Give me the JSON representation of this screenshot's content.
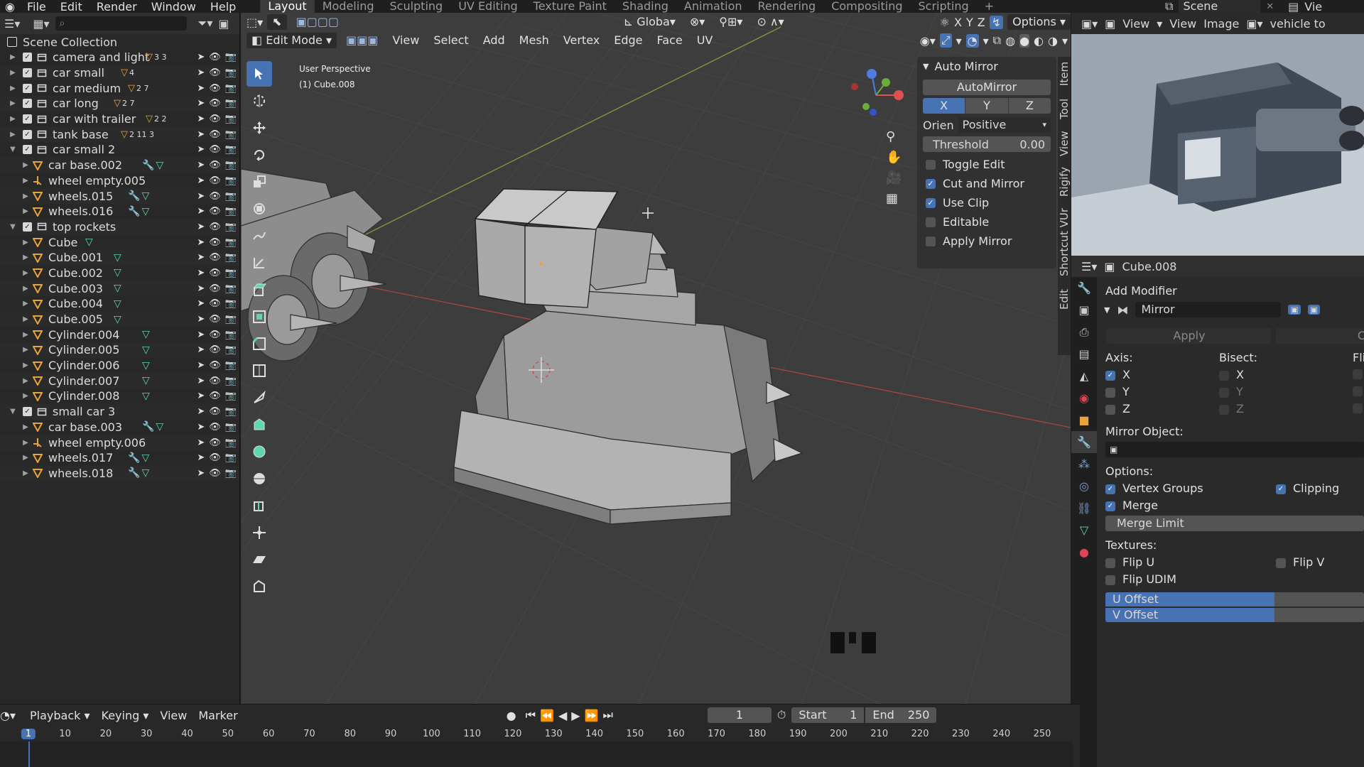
{
  "topbar": {
    "menus": [
      "File",
      "Edit",
      "Render",
      "Window",
      "Help"
    ],
    "workspaces": [
      "Layout",
      "Modeling",
      "Sculpting",
      "UV Editing",
      "Texture Paint",
      "Shading",
      "Animation",
      "Rendering",
      "Compositing",
      "Scripting"
    ],
    "active_workspace": "Layout",
    "add_tab": "+",
    "scene": "Scene",
    "viewlayer": "Vie"
  },
  "outliner": {
    "root": "Scene Collection",
    "rows": [
      {
        "label": "camera and light",
        "type": "collection",
        "depth": 0,
        "expanded": false,
        "badges": "3 3"
      },
      {
        "label": "car small",
        "type": "collection",
        "depth": 0,
        "expanded": false,
        "badges": "4"
      },
      {
        "label": "car medium",
        "type": "collection",
        "depth": 0,
        "expanded": false,
        "badges": "2 7"
      },
      {
        "label": "car long",
        "type": "collection",
        "depth": 0,
        "expanded": false,
        "badges": "2 7"
      },
      {
        "label": "car with trailer",
        "type": "collection",
        "depth": 0,
        "expanded": false,
        "badges": "2 2"
      },
      {
        "label": "tank base",
        "type": "collection",
        "depth": 0,
        "expanded": false,
        "badges": "2 11 3"
      },
      {
        "label": "car small 2",
        "type": "collection",
        "depth": 0,
        "expanded": true,
        "badges": ""
      },
      {
        "label": "car base.002",
        "type": "mesh",
        "depth": 1,
        "expanded": false,
        "badges": "mod"
      },
      {
        "label": "wheel empty.005",
        "type": "empty",
        "depth": 1,
        "expanded": false,
        "badges": ""
      },
      {
        "label": "wheels.015",
        "type": "mesh",
        "depth": 1,
        "expanded": false,
        "badges": "mod"
      },
      {
        "label": "wheels.016",
        "type": "mesh",
        "depth": 1,
        "expanded": false,
        "badges": "mod"
      },
      {
        "label": "top rockets",
        "type": "collection",
        "depth": 0,
        "expanded": true,
        "badges": ""
      },
      {
        "label": "Cube",
        "type": "mesh",
        "depth": 1,
        "expanded": false,
        "badges": "mesh"
      },
      {
        "label": "Cube.001",
        "type": "mesh",
        "depth": 1,
        "expanded": false,
        "badges": "mesh"
      },
      {
        "label": "Cube.002",
        "type": "mesh",
        "depth": 1,
        "expanded": false,
        "badges": "mesh"
      },
      {
        "label": "Cube.003",
        "type": "mesh",
        "depth": 1,
        "expanded": false,
        "badges": "mesh"
      },
      {
        "label": "Cube.004",
        "type": "mesh",
        "depth": 1,
        "expanded": false,
        "badges": "mesh"
      },
      {
        "label": "Cube.005",
        "type": "mesh",
        "depth": 1,
        "expanded": false,
        "badges": "mesh"
      },
      {
        "label": "Cylinder.004",
        "type": "mesh",
        "depth": 1,
        "expanded": false,
        "badges": "mesh"
      },
      {
        "label": "Cylinder.005",
        "type": "mesh",
        "depth": 1,
        "expanded": false,
        "badges": "mesh"
      },
      {
        "label": "Cylinder.006",
        "type": "mesh",
        "depth": 1,
        "expanded": false,
        "badges": "mesh"
      },
      {
        "label": "Cylinder.007",
        "type": "mesh",
        "depth": 1,
        "expanded": false,
        "badges": "mesh"
      },
      {
        "label": "Cylinder.008",
        "type": "mesh",
        "depth": 1,
        "expanded": false,
        "badges": "mesh"
      },
      {
        "label": "small car 3",
        "type": "collection",
        "depth": 0,
        "expanded": true,
        "badges": ""
      },
      {
        "label": "car base.003",
        "type": "mesh",
        "depth": 1,
        "expanded": false,
        "badges": "mod"
      },
      {
        "label": "wheel empty.006",
        "type": "empty",
        "depth": 1,
        "expanded": false,
        "badges": ""
      },
      {
        "label": "wheels.017",
        "type": "mesh",
        "depth": 1,
        "expanded": false,
        "badges": "mod"
      },
      {
        "label": "wheels.018",
        "type": "mesh",
        "depth": 1,
        "expanded": false,
        "badges": "mod"
      }
    ]
  },
  "viewport": {
    "header": {
      "orientation": "Globa",
      "axes": [
        "X",
        "Y",
        "Z"
      ],
      "options": "Options",
      "mode": "Edit Mode",
      "menus": [
        "View",
        "Select",
        "Add",
        "Mesh",
        "Vertex",
        "Edge",
        "Face",
        "UV"
      ]
    },
    "overlay_text": {
      "perspective": "User Perspective",
      "object": "(1) Cube.008"
    },
    "side_tabs": [
      "Item",
      "Tool",
      "View",
      "Rigify",
      "Shortcut VUr",
      "Edit"
    ]
  },
  "auto_mirror": {
    "title": "Auto Mirror",
    "button": "AutoMirror",
    "axes": [
      {
        "label": "X",
        "on": true
      },
      {
        "label": "Y",
        "on": false
      },
      {
        "label": "Z",
        "on": false
      }
    ],
    "orientation_label": "Orien",
    "orientation_value": "Positive",
    "threshold_label": "Threshold",
    "threshold_value": "0.00",
    "checkboxes": [
      {
        "label": "Toggle Edit",
        "on": false
      },
      {
        "label": "Cut and Mirror",
        "on": true
      },
      {
        "label": "Use Clip",
        "on": true
      },
      {
        "label": "Editable",
        "on": false
      },
      {
        "label": "Apply Mirror",
        "on": false
      }
    ]
  },
  "image_editor": {
    "menus": [
      "View",
      "View",
      "Image"
    ],
    "image_name": "vehicle to"
  },
  "properties": {
    "object_name": "Cube.008",
    "add_modifier": "Add Modifier",
    "modifier_name": "Mirror",
    "apply": "Apply",
    "apply_partial": "C",
    "axis_label": "Axis:",
    "bisect_label": "Bisect:",
    "flip_label": "Fli",
    "axis": [
      {
        "label": "X",
        "on": true
      },
      {
        "label": "Y",
        "on": false
      },
      {
        "label": "Z",
        "on": false
      }
    ],
    "bisect": [
      {
        "label": "X",
        "on": false
      },
      {
        "label": "Y",
        "on": false
      },
      {
        "label": "Z",
        "on": false
      }
    ],
    "mirror_object_label": "Mirror Object:",
    "options_label": "Options:",
    "vertex_groups": "Vertex Groups",
    "clipping": "Clipping",
    "merge": "Merge",
    "merge_limit": "Merge Limit",
    "textures_label": "Textures:",
    "flip_u": "Flip U",
    "flip_v": "Flip V",
    "flip_udim": "Flip UDIM",
    "u_offset": "U Offset",
    "v_offset": "V Offset"
  },
  "timeline": {
    "menus": [
      "Playback",
      "Keying",
      "View",
      "Marker"
    ],
    "current_frame": "1",
    "start_label": "Start",
    "start": "1",
    "end_label": "End",
    "end": "250",
    "ruler": [
      "1",
      "10",
      "20",
      "30",
      "40",
      "50",
      "60",
      "70",
      "80",
      "90",
      "100",
      "110",
      "120",
      "130",
      "140",
      "150",
      "160",
      "170",
      "180",
      "190",
      "200",
      "210",
      "220",
      "230",
      "240",
      "250"
    ]
  },
  "colors": {
    "accent": "#4772b3",
    "collection_icon": "#e8a33d",
    "mesh_icon": "#5fd6b0",
    "modifier_icon": "#7d9fd1"
  }
}
